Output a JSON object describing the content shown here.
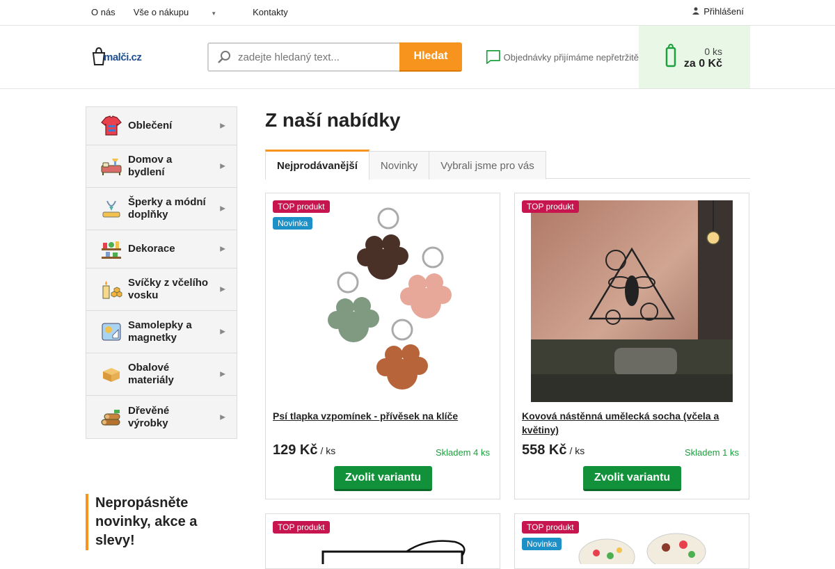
{
  "topbar": {
    "nav": [
      {
        "label": "O nás"
      },
      {
        "label": "Vše o nákupu",
        "has_dropdown": true
      },
      {
        "label": "Kontakty"
      }
    ],
    "login_label": "Přihlášení",
    "login_icon": "user-icon"
  },
  "header": {
    "logo_text": "malči.cz",
    "search_placeholder": "zadejte hledaný text...",
    "search_button": "Hledat",
    "chat_text": "Objednávky přijímáme nepřetržitě",
    "cart_count": "0 ks",
    "cart_total": "za 0 Kč",
    "accent_color": "#f7941d",
    "cart_color": "#1aa03c"
  },
  "sidebar": {
    "categories": [
      {
        "label": "Oblečení",
        "icon": "clothing-icon"
      },
      {
        "label": "Domov a bydlení",
        "icon": "home-icon"
      },
      {
        "label": "Šperky a módní doplňky",
        "icon": "jewelry-icon"
      },
      {
        "label": "Dekorace",
        "icon": "decoration-icon"
      },
      {
        "label": "Svíčky z včelího vosku",
        "icon": "candle-icon"
      },
      {
        "label": "Samolepky a magnetky",
        "icon": "sticker-icon"
      },
      {
        "label": "Obalové materiály",
        "icon": "box-icon"
      },
      {
        "label": "Dřevěné výrobky",
        "icon": "wood-icon"
      }
    ],
    "newsletter_title": "Nepropásněte novinky, akce a slevy!"
  },
  "main": {
    "title": "Z naší nabídky",
    "tabs": [
      {
        "label": "Nejprodávanější",
        "active": true
      },
      {
        "label": "Novinky"
      },
      {
        "label": "Vybrali jsme pro vás"
      }
    ],
    "products": [
      {
        "name": "Psí tlapka vzpomínek - přívěsek na klíče",
        "price": "129 Kč",
        "unit": "/ ks",
        "stock": "Skladem 4 ks",
        "badges": [
          "TOP produkt",
          "Novinka"
        ],
        "button": "Zvolit variantu"
      },
      {
        "name": "Kovová nástěnná umělecká socha (včela a květiny)",
        "price": "558 Kč",
        "unit": "/ ks",
        "stock": "Skladem 1 ks",
        "badges": [
          "TOP produkt"
        ],
        "button": "Zvolit variantu"
      },
      {
        "badges": [
          "TOP produkt"
        ]
      },
      {
        "badges": [
          "TOP produkt",
          "Novinka"
        ]
      }
    ]
  }
}
